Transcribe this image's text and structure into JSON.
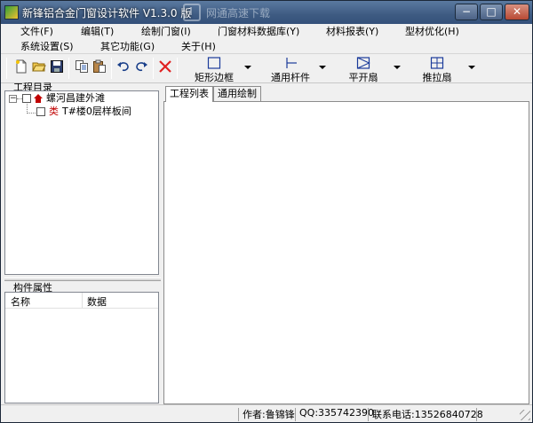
{
  "window": {
    "title": "新锋铝合金门窗设计软件 V1.3.0 版",
    "watermark": "网通高速下载",
    "controls": {
      "minimize": "−",
      "maximize": "□",
      "close": "✕"
    }
  },
  "menu": {
    "row1": [
      "文件(F)",
      "编辑(T)",
      "绘制门窗(I)",
      "门窗材料数据库(Y)",
      "材料报表(Y)",
      "型材优化(H)"
    ],
    "row2": [
      "系统设置(S)",
      "其它功能(G)",
      "关于(H)"
    ]
  },
  "toolbar": {
    "icons": [
      "new-file-icon",
      "open-folder-icon",
      "save-icon",
      "copy-icon",
      "paste-icon",
      "undo-icon",
      "redo-icon",
      "delete-icon"
    ],
    "tools": [
      {
        "label": "矩形边框",
        "icon": "rectangle-frame-icon"
      },
      {
        "label": "通用杆件",
        "icon": "general-bar-icon"
      },
      {
        "label": "平开扇",
        "icon": "casement-sash-icon"
      },
      {
        "label": "推拉扇",
        "icon": "sliding-sash-icon"
      }
    ]
  },
  "left": {
    "project_label": "工程目录",
    "tree": [
      {
        "label": "螺河昌建外滩",
        "prefix": ""
      },
      {
        "label": "T#楼0层样板间",
        "prefix": "类"
      }
    ],
    "props_label": "构件属性",
    "props_columns": [
      "名称",
      "数据"
    ]
  },
  "right": {
    "tabs": [
      "工程列表",
      "通用绘制"
    ]
  },
  "status": {
    "author": "作者:鲁锦锋",
    "qq": "QQ:335742390",
    "phone": "联系电话:13526840728"
  },
  "colors": {
    "titlebar": "#3e5b82",
    "tree_prefix": "#c00000",
    "delete": "#e02020"
  }
}
